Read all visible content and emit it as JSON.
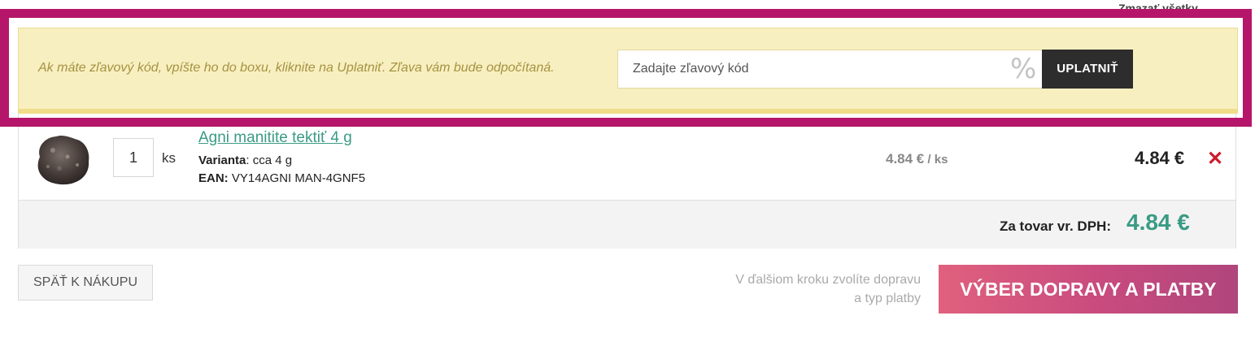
{
  "top": {
    "partial_link": "Zmazať všetky"
  },
  "discount": {
    "info_text": "Ak máte zľavový kód, vpíšte ho do boxu, kliknite na Uplatniť. Zľava vám bude odpočítaná.",
    "placeholder": "Zadajte zľavový kód",
    "percent_symbol": "%",
    "apply_label": "UPLATNIŤ"
  },
  "cart": {
    "items": [
      {
        "name": "Agni manitite tektiť 4 g",
        "quantity": "1",
        "quantity_unit": "ks",
        "variant_label": "Varianta",
        "variant_value": ": cca 4 g",
        "ean_label": "EAN:",
        "ean_value": " VY14AGNI MAN-4GNF5",
        "unit_price": "4.84 €",
        "unit_price_per": " / ks",
        "line_total": "4.84 €",
        "remove_symbol": "✕"
      }
    ],
    "total_label": "Za tovar vr. DPH:",
    "total_value": "4.84 €"
  },
  "actions": {
    "back_label": "SPÄŤ K NÁKUPU",
    "next_hint": "V ďalšiom kroku zvolíte dopravu a typ platby",
    "next_label": "VÝBER DOPRAVY A PLATBY"
  },
  "colors": {
    "highlight": "#b5166a",
    "discount_band": "#f8efc0",
    "accent_green": "#3a9b85",
    "remove_red": "#cc1b2b",
    "apply_button": "#2d2d2d"
  }
}
